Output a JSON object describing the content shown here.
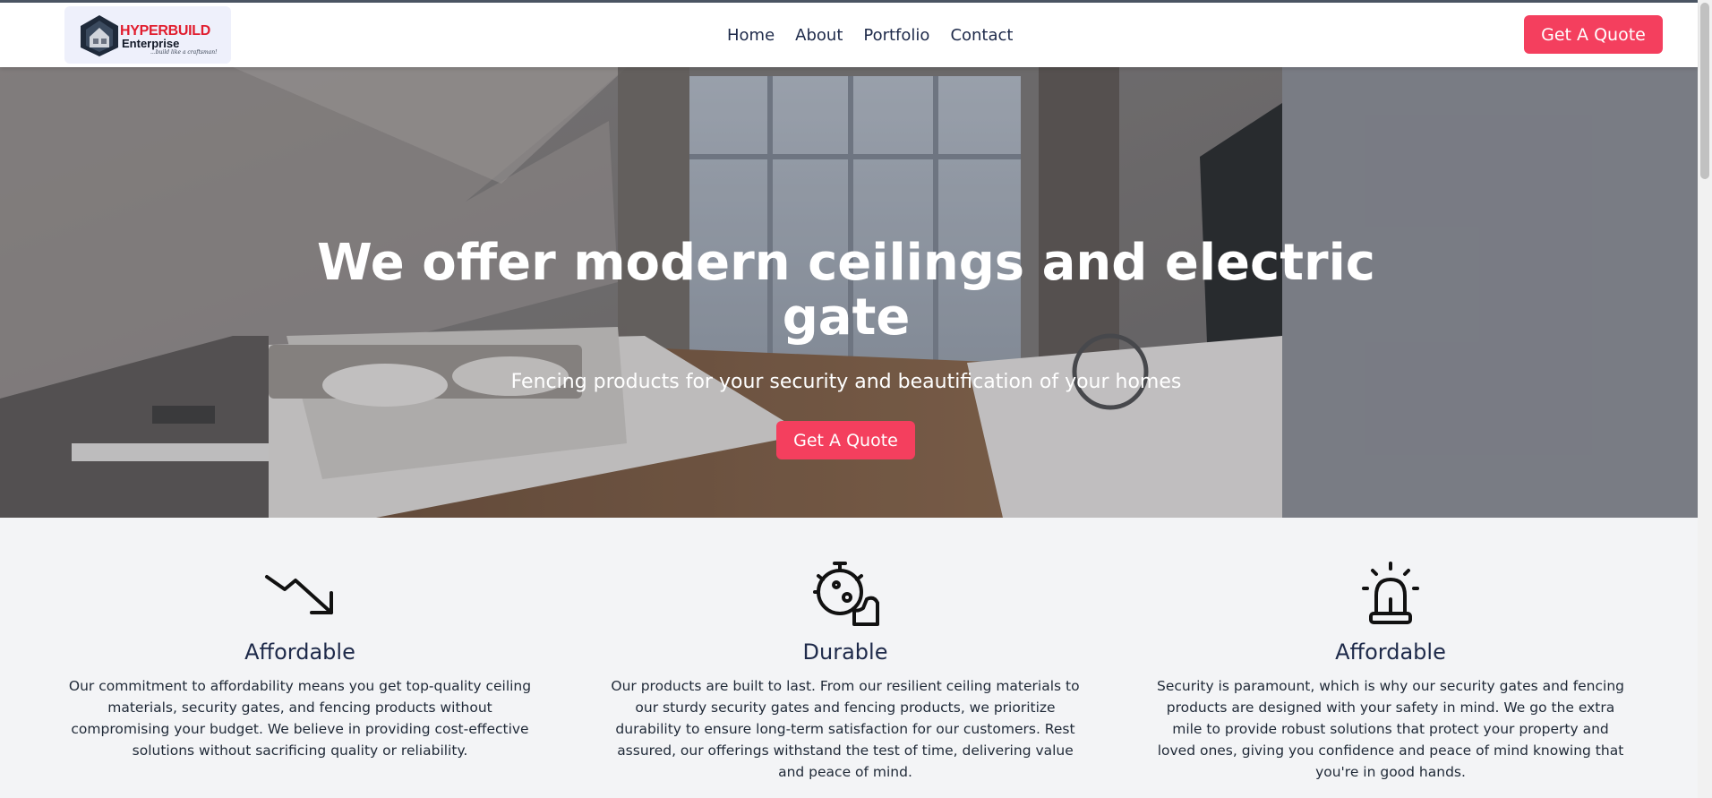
{
  "header": {
    "logo": {
      "brand_line1": "HYPERBUILD",
      "brand_line2": "Enterprise",
      "tagline": "...build like a craftsman!"
    },
    "nav": [
      {
        "label": "Home"
      },
      {
        "label": "About"
      },
      {
        "label": "Portfolio"
      },
      {
        "label": "Contact"
      }
    ],
    "cta_label": "Get A Quote"
  },
  "hero": {
    "title": "We offer modern ceilings and electric gate",
    "subtitle": "Fencing products for your security and beautification of your homes",
    "cta_label": "Get A Quote"
  },
  "features": [
    {
      "icon": "trend-down-icon",
      "title": "Affordable",
      "text": "Our commitment to affordability means you get top-quality ceiling materials, security gates, and fencing products without compromising your budget. We believe in providing cost-effective solutions without sacrificing quality or reliability."
    },
    {
      "icon": "durable-icon",
      "title": "Durable",
      "text": "Our products are built to last. From our resilient ceiling materials to our sturdy security gates and fencing products, we prioritize durability to ensure long-term satisfaction for our customers. Rest assured, our offerings withstand the test of time, delivering value and peace of mind."
    },
    {
      "icon": "siren-icon",
      "title": "Affordable",
      "text": "Security is paramount, which is why our security gates and fencing products are designed with your safety in mind. We go the extra mile to provide robust solutions that protect your property and loved ones, giving you confidence and peace of mind knowing that you're in good hands."
    }
  ],
  "colors": {
    "accent": "#f43f5e",
    "nav_text": "#1e2a4a",
    "section_bg": "#f3f4f6"
  }
}
